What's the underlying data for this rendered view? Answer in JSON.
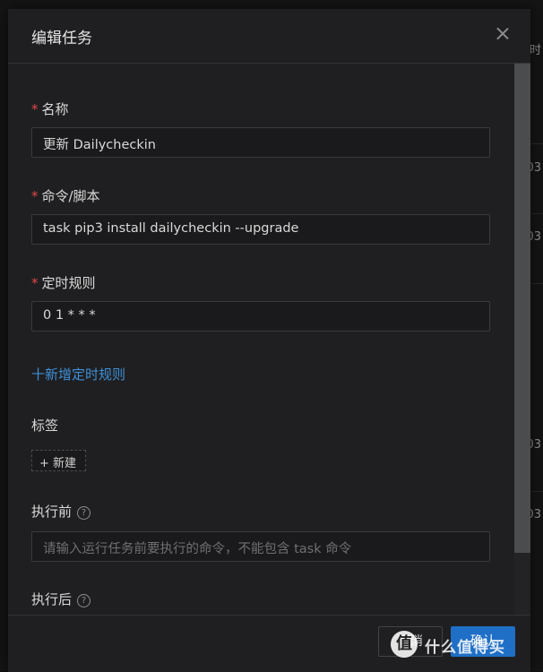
{
  "modal": {
    "title": "编辑任务",
    "fields": {
      "name_label": "名称",
      "name_value": "更新 Dailycheckin",
      "command_label": "命令/脚本",
      "command_value": "task pip3 install dailycheckin --upgrade",
      "schedule_label": "定时规则",
      "schedule_value": "0 1 * * *",
      "add_schedule": "十新增定时规则",
      "tags_label": "标签",
      "new_tag": "+ 新建",
      "before_label": "执行前",
      "before_placeholder": "请输入运行任务前要执行的命令，不能包含 task 命令",
      "after_label": "执行后"
    },
    "footer": {
      "cancel_label": "取消",
      "ok_label": "确认"
    }
  },
  "background": {
    "header_cell": "时",
    "row_cells": [
      "03",
      "03",
      "03",
      "03"
    ]
  },
  "watermark": {
    "logo_char": "值",
    "text": "什么值得买"
  },
  "colors": {
    "accent": "#3f8fd6",
    "primary_button": "#1f6fc6",
    "required": "#e0474a",
    "modal_bg": "#1f1f21"
  }
}
